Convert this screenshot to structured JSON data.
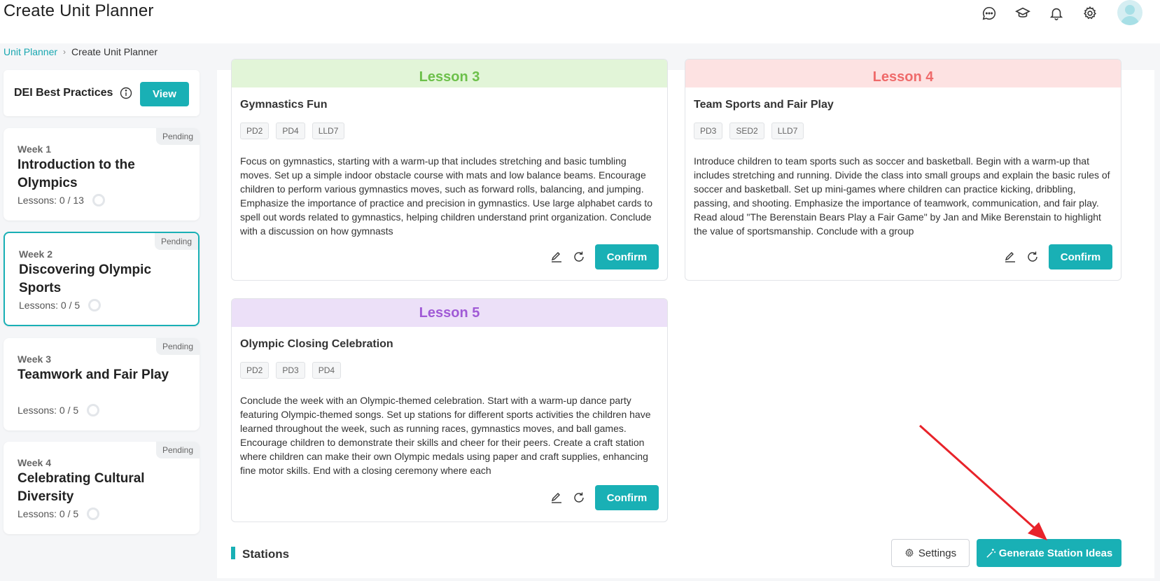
{
  "header": {
    "title": "Create Unit Planner",
    "icons": [
      "chat-icon",
      "graduation-cap-icon",
      "bell-icon",
      "gear-icon"
    ]
  },
  "breadcrumb": {
    "link": "Unit Planner",
    "current": "Create Unit Planner"
  },
  "sidebar": {
    "dei": {
      "title": "DEI Best Practices",
      "view_label": "View"
    },
    "weeks": [
      {
        "badge": "Pending",
        "label": "Week 1",
        "title": "Introduction to the Olympics",
        "lessons": "Lessons: 0 / 13"
      },
      {
        "badge": "Pending",
        "label": "Week 2",
        "title": "Discovering Olympic Sports",
        "lessons": "Lessons: 0 / 5"
      },
      {
        "badge": "Pending",
        "label": "Week 3",
        "title": "Teamwork and Fair Play",
        "lessons": "Lessons: 0 / 5"
      },
      {
        "badge": "Pending",
        "label": "Week 4",
        "title": "Celebrating Cultural Diversity",
        "lessons": "Lessons: 0 / 5"
      }
    ]
  },
  "lessons": [
    {
      "header": "Lesson 3",
      "header_color": "#6cc04a",
      "header_bg": "#e2f5d8",
      "name": "Gymnastics Fun",
      "tags": [
        "PD2",
        "PD4",
        "LLD7"
      ],
      "description": "Focus on gymnastics, starting with a warm-up that includes stretching and basic tumbling moves. Set up a simple indoor obstacle course with mats and low balance beams. Encourage children to perform various gymnastics moves, such as forward rolls, balancing, and jumping. Emphasize the importance of practice and precision in gymnastics. Use large alphabet cards to spell out words related to gymnastics, helping children understand print organization. Conclude with a discussion on how gymnasts",
      "confirm_label": "Confirm"
    },
    {
      "header": "Lesson 4",
      "header_color": "#ef6a6a",
      "header_bg": "#fde2e2",
      "name": "Team Sports and Fair Play",
      "tags": [
        "PD3",
        "SED2",
        "LLD7"
      ],
      "description": "Introduce children to team sports such as soccer and basketball. Begin with a warm-up that includes stretching and running. Divide the class into small groups and explain the basic rules of soccer and basketball. Set up mini-games where children can practice kicking, dribbling, passing, and shooting. Emphasize the importance of teamwork, communication, and fair play. Read aloud \"The Berenstain Bears Play a Fair Game\" by Jan and Mike Berenstain to highlight the value of sportsmanship. Conclude with a group",
      "confirm_label": "Confirm"
    },
    {
      "header": "Lesson 5",
      "header_color": "#a05ad6",
      "header_bg": "#ece0f8",
      "name": "Olympic Closing Celebration",
      "tags": [
        "PD2",
        "PD3",
        "PD4"
      ],
      "description": "Conclude the week with an Olympic-themed celebration. Start with a warm-up dance party featuring Olympic-themed songs. Set up stations for different sports activities the children have learned throughout the week, such as running races, gymnastics moves, and ball games. Encourage children to demonstrate their skills and cheer for their peers. Create a craft station where children can make their own Olympic medals using paper and craft supplies, enhancing fine motor skills. End with a closing ceremony where each",
      "confirm_label": "Confirm"
    }
  ],
  "stations": {
    "title": "Stations",
    "settings_label": "Settings",
    "generate_label": "Generate Station Ideas"
  },
  "colors": {
    "accent": "#19b0b5",
    "arrow": "#e8232a"
  }
}
